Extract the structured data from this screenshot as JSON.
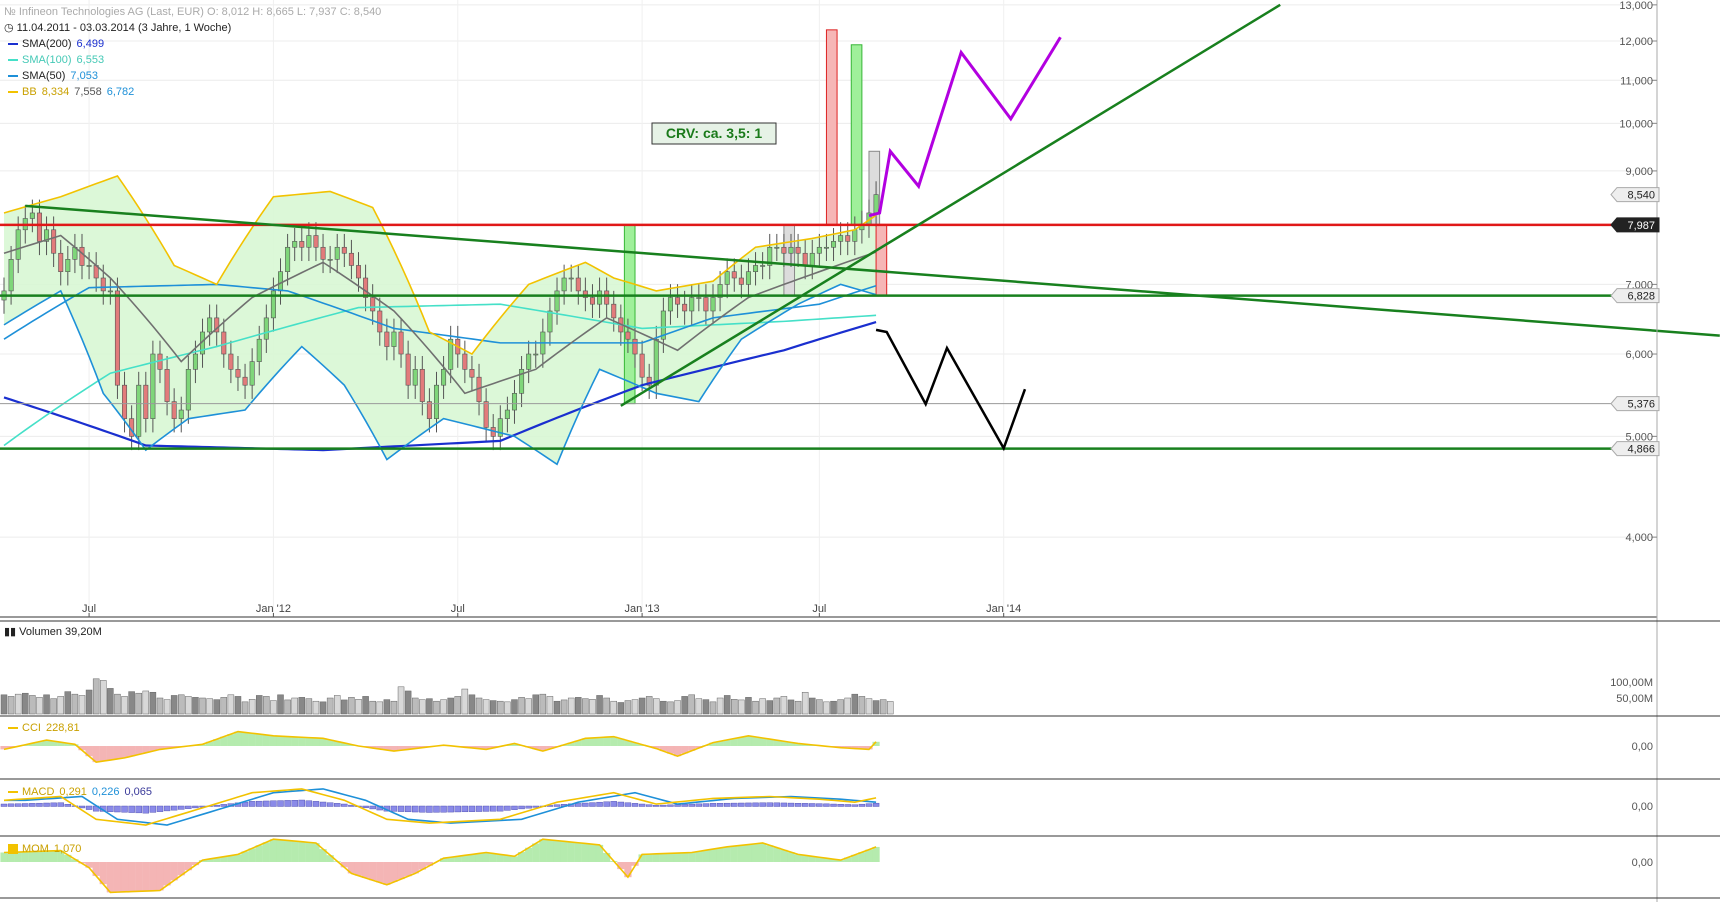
{
  "header": {
    "instrument": "Infineon Technologies AG (Last, EUR)",
    "ohlc": "O: 8,012  H: 8,665  L: 7,937  C: 8,540",
    "range": "11.04.2011 - 03.03.2014 (3 Jahre, 1 Woche)"
  },
  "legend": [
    {
      "name": "SMA(200)",
      "values": "6,499",
      "color": "#1a2fcf"
    },
    {
      "name": "SMA(100)",
      "values": "6,553",
      "color": "#45e0c8"
    },
    {
      "name": "SMA(50)",
      "values": "7,053",
      "color": "#1e90d8"
    },
    {
      "name": "BB",
      "values": [
        "8,334",
        "7,558",
        "6,782"
      ],
      "color": "#f2c200"
    }
  ],
  "annotation": {
    "crv": "CRV:  ca. 3,5: 1"
  },
  "chart_data": [
    {
      "type": "line",
      "title": "Infineon Technologies AG",
      "scale": "log",
      "ylim": [
        3.4,
        13.0
      ],
      "x_ticks": [
        "Jul",
        "Jan '12",
        "Jul",
        "Jan '13",
        "Jul",
        "Jan '14"
      ],
      "y_ticks": [
        "13,000",
        "12,000",
        "11,000",
        "10,000",
        "9,000",
        "7,000",
        "6,000",
        "5,000",
        "4,000"
      ],
      "price_tags": [
        {
          "label": "8,540",
          "value": 8.54,
          "style": "grey"
        },
        {
          "label": "7,987",
          "value": 7.987,
          "style": "dark"
        },
        {
          "label": "6,828",
          "value": 6.828,
          "style": "grey"
        },
        {
          "label": "5,376",
          "value": 5.376,
          "style": "grey"
        },
        {
          "label": "4,866",
          "value": 4.866,
          "style": "grey"
        }
      ],
      "horizontal_lines": [
        {
          "value": 7.987,
          "color": "#e01818"
        },
        {
          "value": 6.828,
          "color": "#18801e"
        },
        {
          "value": 4.866,
          "color": "#18801e"
        },
        {
          "value": 5.376,
          "color": "#9a9a9a"
        }
      ],
      "weekly_close": [
        6.9,
        7.4,
        7.9,
        8.1,
        8.2,
        7.7,
        7.9,
        7.5,
        7.2,
        7.4,
        7.6,
        7.3,
        7.3,
        7.1,
        6.9,
        6.9,
        5.6,
        5.2,
        5.0,
        5.6,
        5.2,
        6.0,
        5.8,
        5.4,
        5.2,
        5.3,
        5.8,
        6.0,
        6.3,
        6.5,
        6.3,
        6.0,
        5.8,
        5.7,
        5.6,
        5.9,
        6.2,
        6.5,
        6.9,
        7.2,
        7.6,
        7.7,
        7.6,
        7.8,
        7.6,
        7.4,
        7.4,
        7.6,
        7.5,
        7.3,
        7.1,
        6.8,
        6.6,
        6.3,
        6.1,
        6.3,
        6.0,
        5.6,
        5.8,
        5.4,
        5.2,
        5.6,
        5.8,
        6.2,
        6.0,
        5.8,
        5.7,
        5.4,
        5.1,
        5.0,
        5.2,
        5.3,
        5.5,
        5.8,
        6.0,
        6.0,
        6.3,
        6.6,
        6.9,
        7.1,
        7.1,
        6.9,
        6.8,
        6.7,
        6.9,
        6.7,
        6.5,
        6.3,
        6.2,
        6.0,
        5.7,
        5.6,
        6.2,
        6.6,
        6.8,
        6.7,
        6.6,
        6.8,
        6.8,
        6.6,
        6.8,
        7.0,
        7.2,
        7.1,
        7.0,
        7.2,
        7.3,
        7.3,
        7.6,
        7.6,
        7.5,
        7.6,
        7.5,
        7.3,
        7.5,
        7.6,
        7.6,
        7.7,
        7.8,
        7.7,
        7.9,
        8.0,
        8.2,
        8.54
      ],
      "series": [
        {
          "name": "SMA(200)",
          "color": "#1a2fcf",
          "anchors": [
            [
              0,
              5.45
            ],
            [
              20,
              4.9
            ],
            [
              45,
              4.85
            ],
            [
              70,
              4.95
            ],
            [
              90,
              5.6
            ],
            [
              110,
              6.05
            ],
            [
              125,
              6.5
            ]
          ]
        },
        {
          "name": "SMA(100)",
          "color": "#45e0c8",
          "anchors": [
            [
              0,
              4.9
            ],
            [
              15,
              5.75
            ],
            [
              30,
              6.1
            ],
            [
              50,
              6.65
            ],
            [
              70,
              6.7
            ],
            [
              90,
              6.35
            ],
            [
              110,
              6.45
            ],
            [
              125,
              6.55
            ]
          ]
        },
        {
          "name": "SMA(50)",
          "color": "#1e90d8",
          "anchors": [
            [
              0,
              6.2
            ],
            [
              12,
              6.95
            ],
            [
              30,
              7.0
            ],
            [
              40,
              6.9
            ],
            [
              55,
              6.35
            ],
            [
              70,
              6.15
            ],
            [
              90,
              6.15
            ],
            [
              100,
              6.5
            ],
            [
              115,
              6.7
            ],
            [
              125,
              7.05
            ]
          ]
        },
        {
          "name": "SMA(20)",
          "color": "#707070",
          "anchors": [
            [
              0,
              7.5
            ],
            [
              8,
              7.8
            ],
            [
              15,
              7.1
            ],
            [
              25,
              5.9
            ],
            [
              35,
              6.8
            ],
            [
              45,
              7.35
            ],
            [
              55,
              6.6
            ],
            [
              65,
              5.5
            ],
            [
              75,
              5.8
            ],
            [
              85,
              6.5
            ],
            [
              95,
              6.05
            ],
            [
              105,
              6.8
            ],
            [
              115,
              7.2
            ],
            [
              125,
              7.6
            ]
          ]
        },
        {
          "name": "BB upper",
          "color": "#f2c200",
          "anchors": [
            [
              0,
              8.2
            ],
            [
              8,
              8.5
            ],
            [
              16,
              8.9
            ],
            [
              24,
              7.3
            ],
            [
              30,
              7.0
            ],
            [
              38,
              8.5
            ],
            [
              46,
              8.6
            ],
            [
              52,
              8.3
            ],
            [
              60,
              6.3
            ],
            [
              66,
              6.0
            ],
            [
              74,
              7.0
            ],
            [
              82,
              7.35
            ],
            [
              86,
              7.1
            ],
            [
              92,
              6.9
            ],
            [
              100,
              7.05
            ],
            [
              106,
              7.6
            ],
            [
              114,
              7.75
            ],
            [
              120,
              7.9
            ],
            [
              125,
              8.33
            ]
          ]
        },
        {
          "name": "BB lower",
          "color": "#1e90d8",
          "anchors": [
            [
              0,
              6.4
            ],
            [
              8,
              6.9
            ],
            [
              14,
              5.5
            ],
            [
              20,
              4.85
            ],
            [
              26,
              5.2
            ],
            [
              34,
              5.3
            ],
            [
              42,
              6.1
            ],
            [
              48,
              5.6
            ],
            [
              54,
              4.75
            ],
            [
              62,
              5.2
            ],
            [
              72,
              5.0
            ],
            [
              78,
              4.7
            ],
            [
              84,
              5.8
            ],
            [
              92,
              5.5
            ],
            [
              98,
              5.4
            ],
            [
              104,
              6.2
            ],
            [
              112,
              6.7
            ],
            [
              118,
              7.0
            ],
            [
              125,
              6.78
            ]
          ]
        }
      ],
      "trend_lines": [
        {
          "name": "Abwärtstrend",
          "from": [
            3,
            8.33
          ],
          "to": [
            242,
            6.25
          ],
          "color": "#18801e"
        },
        {
          "name": "Aufwärtstrend",
          "from": [
            87,
            5.35
          ],
          "to": [
            180,
            13.0
          ],
          "color": "#18801e"
        }
      ],
      "scenario_up": [
        [
          122,
          8.15
        ],
        [
          123.5,
          8.2
        ],
        [
          125,
          9.4
        ],
        [
          129,
          8.7
        ],
        [
          135,
          11.7
        ],
        [
          142,
          10.1
        ],
        [
          149,
          12.1
        ]
      ],
      "scenario_down": [
        [
          123,
          6.33
        ],
        [
          124.5,
          6.3
        ],
        [
          130,
          5.37
        ],
        [
          133,
          6.08
        ],
        [
          141,
          4.87
        ],
        [
          144,
          5.55
        ]
      ],
      "boxes": [
        {
          "from": [
            87.5,
            7.987
          ],
          "to": [
            89,
            5.376
          ],
          "color": "green"
        },
        {
          "from": [
            110,
            7.987
          ],
          "to": [
            111.5,
            6.828
          ],
          "color": "grey"
        },
        {
          "from": [
            116,
            7.987
          ],
          "to": [
            117.5,
            12.3
          ],
          "color": "red"
        },
        {
          "from": [
            119.5,
            7.987
          ],
          "to": [
            121,
            11.9
          ],
          "color": "green"
        },
        {
          "from": [
            122,
            7.987
          ],
          "to": [
            123.5,
            9.4
          ],
          "color": "grey"
        },
        {
          "from": [
            123,
            7.987
          ],
          "to": [
            124.5,
            6.828
          ],
          "color": "red"
        }
      ]
    },
    {
      "type": "bar",
      "title": "Volumen",
      "value_label": "39,20M",
      "y_ticks": [
        "100,00M",
        "50,00M"
      ],
      "values": [
        60,
        55,
        62,
        65,
        58,
        52,
        60,
        48,
        55,
        70,
        62,
        58,
        75,
        110,
        105,
        80,
        62,
        55,
        70,
        65,
        72,
        68,
        50,
        45,
        58,
        60,
        55,
        52,
        50,
        48,
        45,
        52,
        60,
        55,
        38,
        46,
        58,
        55,
        42,
        60,
        44,
        50,
        52,
        48,
        40,
        38,
        50,
        58,
        44,
        52,
        46,
        55,
        40,
        38,
        45,
        40,
        85,
        72,
        50,
        45,
        48,
        40,
        45,
        50,
        55,
        78,
        60,
        50,
        45,
        42,
        40,
        38,
        45,
        52,
        48,
        60,
        62,
        55,
        40,
        44,
        50,
        52,
        48,
        46,
        58,
        50,
        40,
        36,
        42,
        45,
        50,
        55,
        48,
        40,
        38,
        42,
        55,
        60,
        48,
        45,
        38,
        50,
        58,
        46,
        44,
        52,
        40,
        48,
        42,
        50,
        55,
        44,
        40,
        68,
        50,
        45,
        38,
        40,
        45,
        50,
        62,
        55,
        48,
        42,
        45,
        39.2
      ]
    },
    {
      "type": "area",
      "title": "CCI",
      "value_label": "228,81",
      "y_ticks": [
        "0,00"
      ],
      "anchors": [
        [
          0,
          -40
        ],
        [
          6,
          70
        ],
        [
          10,
          20
        ],
        [
          13,
          -190
        ],
        [
          17,
          -140
        ],
        [
          22,
          -40
        ],
        [
          28,
          20
        ],
        [
          33,
          170
        ],
        [
          38,
          120
        ],
        [
          45,
          90
        ],
        [
          50,
          0
        ],
        [
          55,
          -60
        ],
        [
          62,
          10
        ],
        [
          68,
          -40
        ],
        [
          72,
          30
        ],
        [
          76,
          -60
        ],
        [
          82,
          90
        ],
        [
          86,
          110
        ],
        [
          92,
          -30
        ],
        [
          95,
          -120
        ],
        [
          100,
          40
        ],
        [
          105,
          120
        ],
        [
          112,
          30
        ],
        [
          118,
          -20
        ],
        [
          122,
          -40
        ],
        [
          125,
          228.81
        ]
      ]
    },
    {
      "type": "line",
      "title": "MACD",
      "values_label": [
        "0,291",
        "0,226",
        "0,065"
      ],
      "y_ticks": [
        "0,00"
      ],
      "anchors": [
        [
          0,
          0.15
        ],
        [
          8,
          0.25
        ],
        [
          13,
          -0.35
        ],
        [
          20,
          -0.5
        ],
        [
          28,
          -0.05
        ],
        [
          35,
          0.35
        ],
        [
          42,
          0.45
        ],
        [
          48,
          0.15
        ],
        [
          54,
          -0.35
        ],
        [
          60,
          -0.45
        ],
        [
          70,
          -0.35
        ],
        [
          78,
          0.1
        ],
        [
          86,
          0.35
        ],
        [
          92,
          0.05
        ],
        [
          100,
          0.2
        ],
        [
          108,
          0.25
        ],
        [
          115,
          0.18
        ],
        [
          120,
          0.1
        ],
        [
          125,
          0.29
        ]
      ]
    },
    {
      "type": "area",
      "title": "MOM",
      "value_label": "1,070",
      "y_ticks": [
        "0,00"
      ],
      "anchors": [
        [
          0,
          0.5
        ],
        [
          8,
          0.6
        ],
        [
          12,
          -0.3
        ],
        [
          15,
          -1.6
        ],
        [
          22,
          -1.5
        ],
        [
          28,
          0.1
        ],
        [
          33,
          0.4
        ],
        [
          38,
          1.2
        ],
        [
          44,
          1.0
        ],
        [
          49,
          -0.6
        ],
        [
          54,
          -1.2
        ],
        [
          58,
          -0.6
        ],
        [
          62,
          0.2
        ],
        [
          68,
          0.5
        ],
        [
          72,
          0.3
        ],
        [
          76,
          1.2
        ],
        [
          84,
          0.9
        ],
        [
          88,
          -0.8
        ],
        [
          90,
          0.4
        ],
        [
          97,
          0.5
        ],
        [
          102,
          0.8
        ],
        [
          107,
          1.0
        ],
        [
          112,
          0.4
        ],
        [
          118,
          0.1
        ],
        [
          125,
          1.07
        ]
      ]
    }
  ]
}
